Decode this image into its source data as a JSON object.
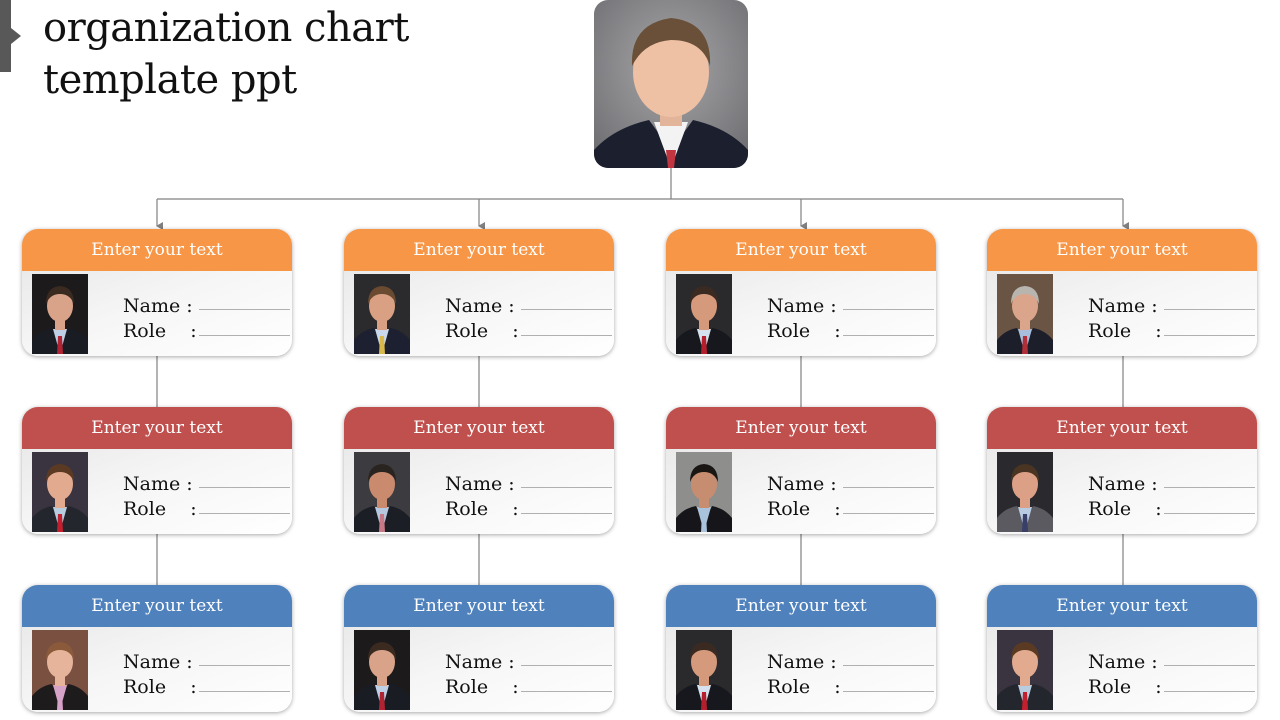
{
  "slide": {
    "title": "organization chart\ntemplate ppt",
    "colors": {
      "level1": "#F79646",
      "level2": "#C0504D",
      "level3": "#4F81BD",
      "connector": "#808080",
      "side_tab": "#585858"
    },
    "top": {
      "photo_icon": "person-photo-icon"
    },
    "columns": [
      {
        "cards": [
          {
            "header": "Enter your text",
            "name_label": "Name :",
            "role_label": "Role    :",
            "photo": "man-smiling-red-tie"
          },
          {
            "header": "Enter your text",
            "name_label": "Name :",
            "role_label": "Role    :",
            "photo": "man-glasses-red-tie"
          },
          {
            "header": "Enter your text",
            "name_label": "Name :",
            "role_label": "Role    :",
            "photo": "woman-pink-turtleneck"
          }
        ]
      },
      {
        "cards": [
          {
            "header": "Enter your text",
            "name_label": "Name :",
            "role_label": "Role    :",
            "photo": "man-glasses-yellow-tie"
          },
          {
            "header": "Enter your text",
            "name_label": "Name :",
            "role_label": "Role    :",
            "photo": "man-pink-tie"
          },
          {
            "header": "Enter your text",
            "name_label": "Name :",
            "role_label": "Role    :",
            "photo": "man-smiling-red-tie"
          }
        ]
      },
      {
        "cards": [
          {
            "header": "Enter your text",
            "name_label": "Name :",
            "role_label": "Role    :",
            "photo": "man-bald-red-tie"
          },
          {
            "header": "Enter your text",
            "name_label": "Name :",
            "role_label": "Role    :",
            "photo": "man-open-collar"
          },
          {
            "header": "Enter your text",
            "name_label": "Name :",
            "role_label": "Role    :",
            "photo": "man-bald-red-tie"
          }
        ]
      },
      {
        "cards": [
          {
            "header": "Enter your text",
            "name_label": "Name :",
            "role_label": "Role    :",
            "photo": "man-gray-hair-red-tie"
          },
          {
            "header": "Enter your text",
            "name_label": "Name :",
            "role_label": "Role    :",
            "photo": "man-gray-suit"
          },
          {
            "header": "Enter your text",
            "name_label": "Name :",
            "role_label": "Role    :",
            "photo": "man-glasses-red-tie"
          }
        ]
      }
    ]
  }
}
